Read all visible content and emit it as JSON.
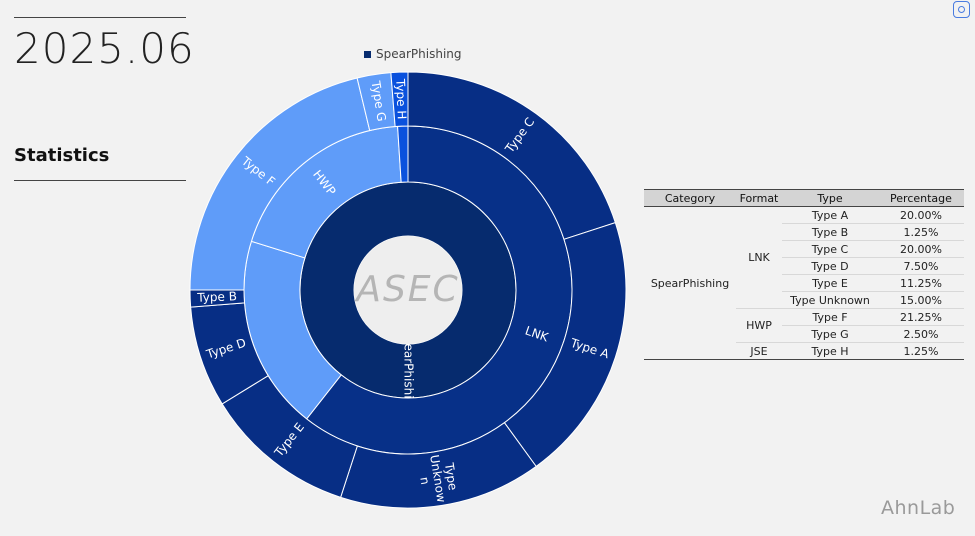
{
  "header": {
    "date": "2025.06",
    "section_title": "Statistics"
  },
  "brand": {
    "name": "AhnLab",
    "center_logo": "ASEC"
  },
  "colors": {
    "spearphishing": "#062b6e",
    "lnk": "#073088",
    "lnk_type": "#072e85",
    "hwp": "#5f9cf9",
    "hwp_type": "#5f9cf9",
    "jse": "#0a51dd",
    "center": "#eeeeee",
    "separator": "#ffffff",
    "legend_swatch": "#062b6e",
    "background": "#f2f2f2"
  },
  "icons": {
    "corner": "screen-capture-icon"
  },
  "table": {
    "headers": [
      "Category",
      "Format",
      "Type",
      "Percentage"
    ],
    "category": "SpearPhishing",
    "formats": [
      {
        "name": "LNK",
        "rows": [
          {
            "type": "Type A",
            "percentage": "20.00%"
          },
          {
            "type": "Type B",
            "percentage": "1.25%"
          },
          {
            "type": "Type C",
            "percentage": "20.00%"
          },
          {
            "type": "Type D",
            "percentage": "7.50%"
          },
          {
            "type": "Type E",
            "percentage": "11.25%"
          },
          {
            "type": "Type Unknown",
            "percentage": "15.00%"
          }
        ]
      },
      {
        "name": "HWP",
        "rows": [
          {
            "type": "Type F",
            "percentage": "21.25%"
          },
          {
            "type": "Type G",
            "percentage": "2.50%"
          }
        ]
      },
      {
        "name": "JSE",
        "rows": [
          {
            "type": "Type H",
            "percentage": "1.25%"
          }
        ]
      }
    ]
  },
  "chart_data": {
    "type": "sunburst",
    "legend": [
      "SpearPhishing"
    ],
    "legend_position": "top",
    "rings": [
      {
        "level": "category",
        "items": [
          {
            "label": "SpearPhishing",
            "value": 100
          }
        ]
      },
      {
        "level": "format",
        "items": [
          {
            "label": "LNK",
            "value": 75.0
          },
          {
            "label": "",
            "value": 23.75
          },
          {
            "label": "HWP",
            "value": 23.75
          },
          {
            "label": "",
            "value": 1.25
          }
        ]
      },
      {
        "level": "type",
        "items": [
          {
            "label": "Type C",
            "value": 20.0
          },
          {
            "label": "Type A",
            "value": 20.0
          },
          {
            "label": "Type\nUnknow\nn",
            "value": 15.0
          },
          {
            "label": "Type E",
            "value": 11.25
          },
          {
            "label": "Type D",
            "value": 7.5
          },
          {
            "label": "Type B",
            "value": 1.25
          },
          {
            "label": "Type F",
            "value": 21.25
          },
          {
            "label": "Type G",
            "value": 2.5
          },
          {
            "label": "Type H",
            "value": 1.25
          }
        ]
      }
    ]
  }
}
